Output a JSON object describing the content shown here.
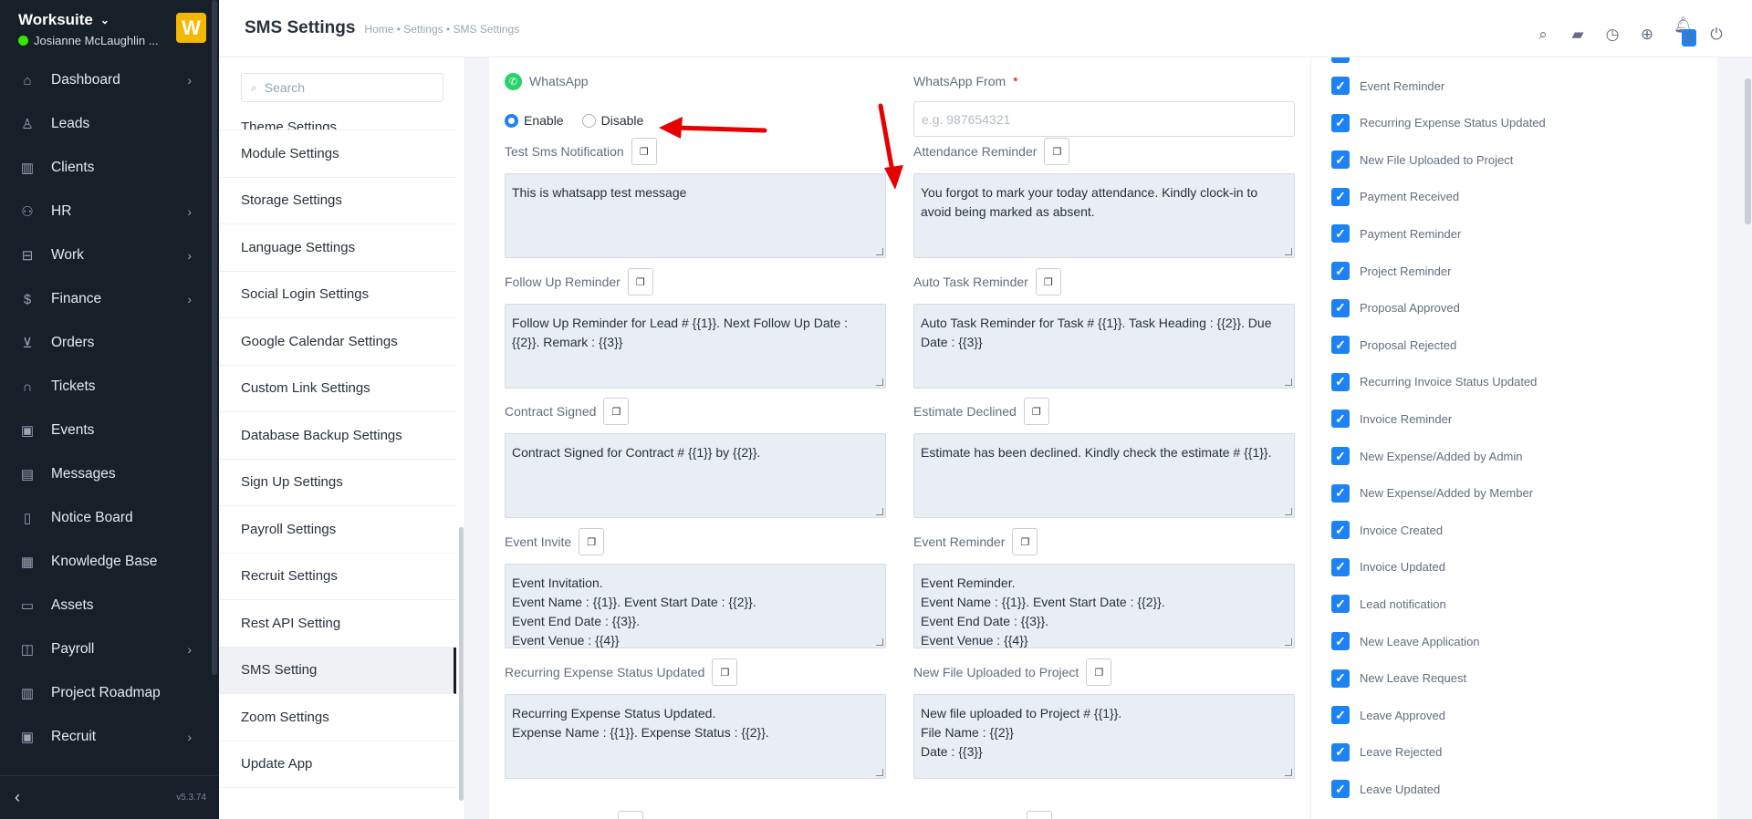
{
  "app": {
    "name": "Worksuite",
    "user": "Josianne McLaughlin ...",
    "logo_letter": "W",
    "version": "v5.3.74"
  },
  "sidebar": {
    "items": [
      {
        "label": "Dashboard",
        "icon": "house-icon",
        "glyph": "⌂",
        "arrow": true
      },
      {
        "label": "Leads",
        "icon": "person-icon",
        "glyph": "♙",
        "arrow": false
      },
      {
        "label": "Clients",
        "icon": "building-icon",
        "glyph": "▥",
        "arrow": false
      },
      {
        "label": "HR",
        "icon": "people-icon",
        "glyph": "⚇",
        "arrow": true
      },
      {
        "label": "Work",
        "icon": "briefcase-icon",
        "glyph": "⊟",
        "arrow": true
      },
      {
        "label": "Finance",
        "icon": "dollar-icon",
        "glyph": "$",
        "arrow": true
      },
      {
        "label": "Orders",
        "icon": "cart-icon",
        "glyph": "⊻",
        "arrow": false
      },
      {
        "label": "Tickets",
        "icon": "headset-icon",
        "glyph": "∩",
        "arrow": false
      },
      {
        "label": "Events",
        "icon": "calendar-icon",
        "glyph": "▣",
        "arrow": false
      },
      {
        "label": "Messages",
        "icon": "chat-icon",
        "glyph": "▤",
        "arrow": false
      },
      {
        "label": "Notice Board",
        "icon": "clipboard-icon",
        "glyph": "▯",
        "arrow": false
      },
      {
        "label": "Knowledge Base",
        "icon": "book-icon",
        "glyph": "▦",
        "arrow": false
      },
      {
        "label": "Assets",
        "icon": "monitor-icon",
        "glyph": "▭",
        "arrow": false
      },
      {
        "label": "Payroll",
        "icon": "wallet-icon",
        "glyph": "◫",
        "arrow": true
      },
      {
        "label": "Project Roadmap",
        "icon": "roadmap-icon",
        "glyph": "▥",
        "arrow": false
      },
      {
        "label": "Recruit",
        "icon": "id-badge-icon",
        "glyph": "▣",
        "arrow": true
      }
    ]
  },
  "header": {
    "title": "SMS Settings",
    "breadcrumb": "Home • Settings • SMS Settings",
    "notification_count": "8"
  },
  "settings_menu": {
    "search_placeholder": "Search",
    "partial_item": "Theme Settings",
    "items": [
      "Module Settings",
      "Storage Settings",
      "Language Settings",
      "Social Login Settings",
      "Google Calendar Settings",
      "Custom Link Settings",
      "Database Backup Settings",
      "Sign Up Settings",
      "Payroll Settings",
      "Recruit Settings",
      "Rest API Setting",
      "SMS Setting",
      "Zoom Settings",
      "Update App"
    ],
    "active": "SMS Setting"
  },
  "whatsapp": {
    "label": "WhatsApp",
    "enable_label": "Enable",
    "disable_label": "Disable",
    "selected": "Enable",
    "from_label": "WhatsApp From",
    "from_required": "*",
    "from_placeholder": "e.g. 987654321"
  },
  "templates": [
    {
      "label": "Test Sms Notification",
      "text": "This is whatsapp test message"
    },
    {
      "label": "Attendance Reminder",
      "text": "You forgot to mark your today attendance. Kindly clock-in to avoid being marked as absent."
    },
    {
      "label": "Follow Up Reminder",
      "text": "Follow Up Reminder for Lead # {{1}}. Next Follow Up Date : {{2}}. Remark : {{3}}"
    },
    {
      "label": "Auto Task Reminder",
      "text": "Auto Task Reminder for Task # {{1}}. Task Heading : {{2}}. Due Date : {{3}}"
    },
    {
      "label": "Contract Signed",
      "text": "Contract Signed for Contract # {{1}} by {{2}}."
    },
    {
      "label": "Estimate Declined",
      "text": "Estimate has been declined. Kindly check the estimate # {{1}}."
    },
    {
      "label": "Event Invite",
      "text": "Event Invitation.\nEvent Name : {{1}}. Event Start Date : {{2}}.\nEvent End Date : {{3}}.\nEvent Venue : {{4}}"
    },
    {
      "label": "Event Reminder",
      "text": "Event Reminder.\nEvent Name : {{1}}. Event Start Date : {{2}}.\nEvent End Date : {{3}}.\nEvent Venue : {{4}}"
    },
    {
      "label": "Recurring Expense Status Updated",
      "text": "Recurring Expense Status Updated.\nExpense Name : {{1}}. Expense Status : {{2}}."
    },
    {
      "label": "New File Uploaded to Project",
      "text": "New file uploaded to Project # {{1}}.\nFile Name : {{2}}\nDate : {{3}}"
    }
  ],
  "notifications": [
    "Event Reminder",
    "Recurring Expense Status Updated",
    "New File Uploaded to Project",
    "Payment Received",
    "Payment Reminder",
    "Project Reminder",
    "Proposal Approved",
    "Proposal Rejected",
    "Recurring Invoice Status Updated",
    "Invoice Reminder",
    "New Expense/Added by Admin",
    "New Expense/Added by Member",
    "Invoice Created",
    "Invoice Updated",
    "Lead notification",
    "New Leave Application",
    "New Leave Request",
    "Leave Approved",
    "Leave Rejected",
    "Leave Updated"
  ],
  "colors": {
    "sidebar_bg": "#171f29",
    "accent": "#1d82f5",
    "annotation_arrow": "#e60000",
    "whatsapp": "#25d366"
  }
}
